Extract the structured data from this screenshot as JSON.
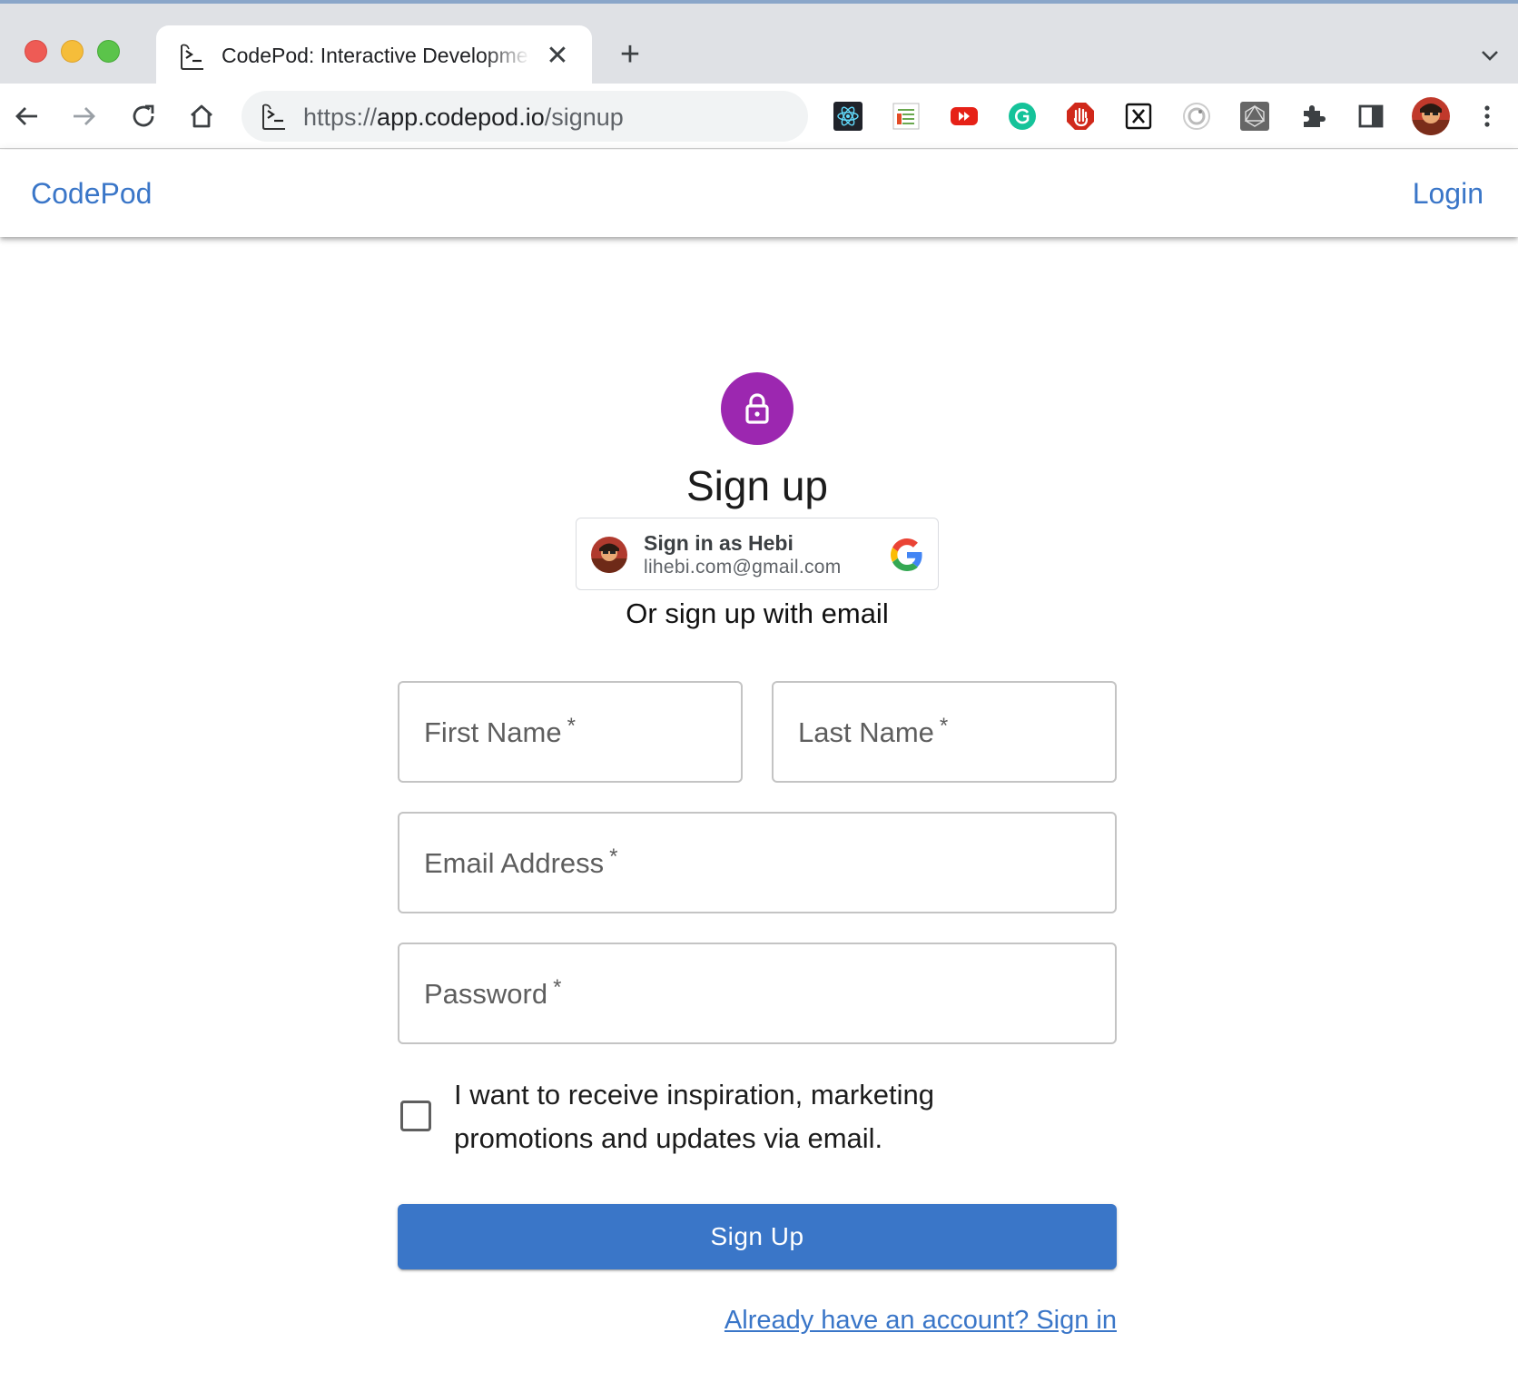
{
  "browser": {
    "tab_title": "CodePod: Interactive Development",
    "tab_close_icon": "close-icon",
    "new_tab_label": "+",
    "url_scheme": "https://",
    "url_host": "app.codepod.io",
    "url_path": "/signup",
    "extensions": [
      "react-devtools-icon",
      "html5-outliner-icon",
      "youtube-ext-icon",
      "grammarly-icon",
      "adblock-icon",
      "notion-web-clipper-icon",
      "pocket-ext-icon",
      "graphql-ext-icon",
      "extensions-puzzle-icon",
      "side-panel-icon"
    ]
  },
  "appbar": {
    "brand": "CodePod",
    "login": "Login"
  },
  "signup": {
    "heading": "Sign up",
    "google": {
      "name": "Sign in as Hebi",
      "email": "lihebi.com@gmail.com"
    },
    "or_text": "Or sign up with email",
    "fields": {
      "first_name": "First Name",
      "last_name": "Last Name",
      "email": "Email Address",
      "password": "Password",
      "required_mark": "*"
    },
    "marketing_checkbox": "I want to receive inspiration, marketing promotions and updates via email.",
    "submit": "Sign Up",
    "signin_link": "Already have an account? Sign in"
  },
  "colors": {
    "primary": "#3a76c8",
    "lock_avatar": "#9c27b0"
  }
}
